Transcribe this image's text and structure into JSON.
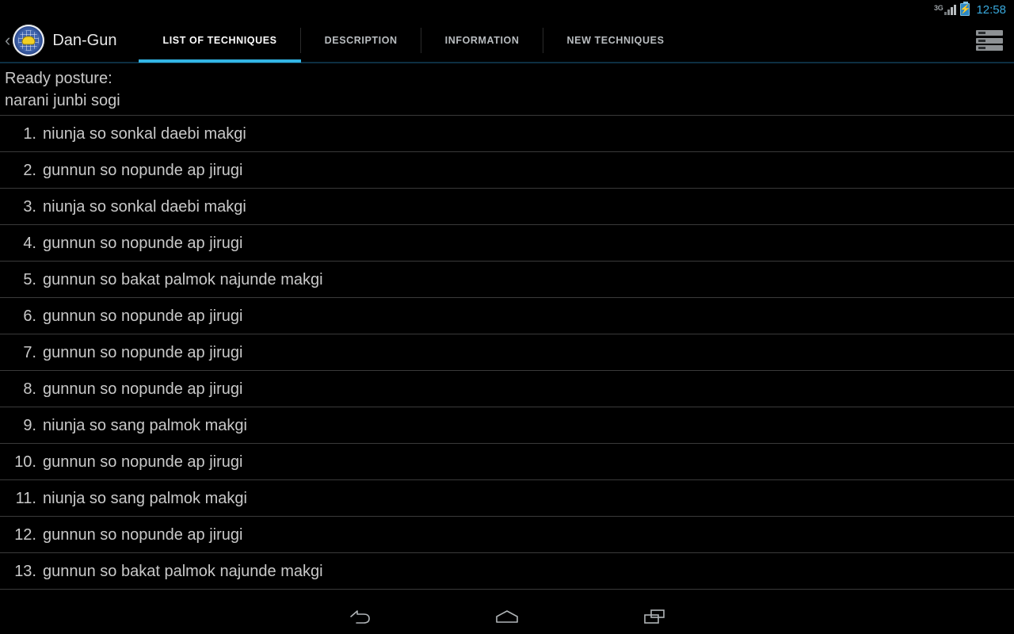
{
  "statusbar": {
    "network_label": "3G",
    "time": "12:58",
    "signal_icon": "signal-bars-icon",
    "battery_icon": "battery-charging-icon",
    "accent_color": "#39a9dd"
  },
  "actionbar": {
    "back_label": "‹",
    "logo_icon": "app-logo-icon",
    "title": "Dan-Gun",
    "menu_icon": "list-menu-icon",
    "active_tab_color": "#33b5e5",
    "tabs": [
      {
        "label": "LIST OF TECHNIQUES",
        "active": true
      },
      {
        "label": "DESCRIPTION",
        "active": false
      },
      {
        "label": "INFORMATION",
        "active": false
      },
      {
        "label": "NEW TECHNIQUES",
        "active": false
      }
    ]
  },
  "ready_posture": {
    "line1": "Ready posture:",
    "line2": "narani junbi sogi"
  },
  "techniques": [
    {
      "num": "1.",
      "text": "niunja so sonkal daebi makgi"
    },
    {
      "num": "2.",
      "text": "gunnun so nopunde ap jirugi"
    },
    {
      "num": "3.",
      "text": "niunja so sonkal daebi makgi"
    },
    {
      "num": "4.",
      "text": "gunnun so nopunde ap jirugi"
    },
    {
      "num": "5.",
      "text": "gunnun so bakat palmok najunde makgi"
    },
    {
      "num": "6.",
      "text": "gunnun so nopunde ap jirugi"
    },
    {
      "num": "7.",
      "text": "gunnun so nopunde ap jirugi"
    },
    {
      "num": "8.",
      "text": "gunnun so nopunde ap jirugi"
    },
    {
      "num": "9.",
      "text": "niunja so sang palmok makgi"
    },
    {
      "num": "10.",
      "text": "gunnun so nopunde ap jirugi"
    },
    {
      "num": "11.",
      "text": "niunja so sang palmok makgi"
    },
    {
      "num": "12.",
      "text": "gunnun so nopunde ap jirugi"
    },
    {
      "num": "13.",
      "text": "gunnun so bakat palmok najunde makgi"
    }
  ],
  "navbar": {
    "back_icon": "back-arrow-icon",
    "home_icon": "home-icon",
    "recents_icon": "recent-apps-icon"
  }
}
